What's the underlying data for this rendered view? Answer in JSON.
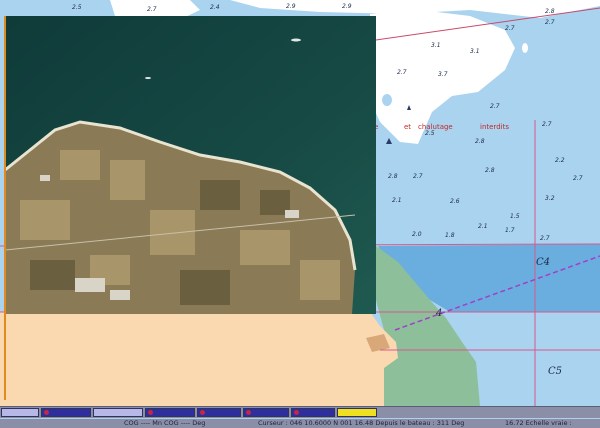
{
  "chart": {
    "soundings": [
      "2.5",
      "2.7",
      "2.4",
      "2.9",
      "2.9",
      "2.8",
      "2.7",
      "2.7",
      "3.1",
      "3.1",
      "2.7",
      "3.7",
      "2.7",
      "2.5",
      "2.8",
      "2.7",
      "2.8",
      "2.8",
      "2.2",
      "2.7",
      "2.7",
      "3.2",
      "2.1",
      "2.6",
      "1.5",
      "2.1",
      "2.0",
      "1.8",
      "1.7",
      "2.7"
    ],
    "labels": {
      "et": "et",
      "chalutage": "chalutage",
      "interdits": "interdits"
    },
    "zones": {
      "c4": "C4",
      "c5": "C5",
      "s4": "4"
    },
    "colors": {
      "sea": "#a9d3ef",
      "deep": "#6aaee0",
      "land": "#fbd9b0",
      "marsh": "#8cbf9a",
      "photo_sea": "#13433f"
    }
  },
  "taskbar": {
    "buttons": [
      {
        "style": "light",
        "name": "task-button-1"
      },
      {
        "style": "dark",
        "name": "task-button-2"
      },
      {
        "style": "light",
        "name": "task-button-3"
      },
      {
        "style": "dark",
        "name": "task-button-4"
      },
      {
        "style": "dark",
        "name": "task-button-5"
      },
      {
        "style": "dark",
        "name": "task-button-6"
      },
      {
        "style": "dark",
        "name": "task-button-7"
      },
      {
        "style": "yellow",
        "name": "task-button-8"
      }
    ]
  },
  "status": {
    "cog": "COG ---- Mn COG ---- Deg",
    "cursor": "Curseur : 046 10.6000 N 001 16.48 Depuis le bateau : 311 Deg",
    "scale": "16.72 Echelle vraie :"
  }
}
